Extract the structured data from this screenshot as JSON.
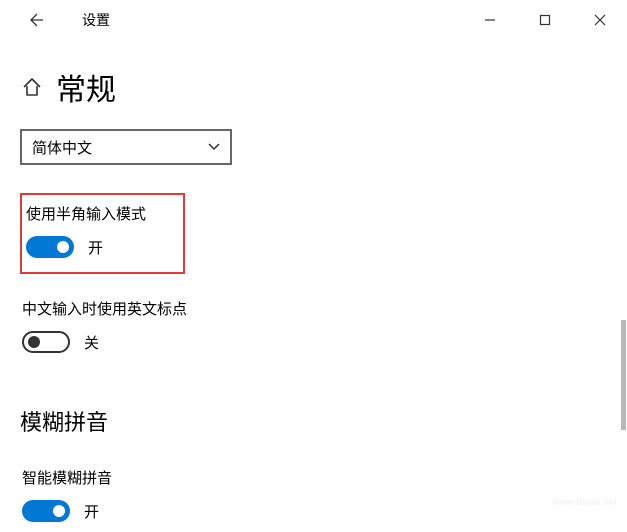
{
  "titlebar": {
    "title": "设置"
  },
  "page": {
    "heading": "常规"
  },
  "dropdown": {
    "selected": "简体中文"
  },
  "settings": {
    "halfwidth": {
      "label": "使用半角输入模式",
      "state": "开"
    },
    "englishPunctuation": {
      "label": "中文输入时使用英文标点",
      "state": "关"
    }
  },
  "sections": {
    "fuzzyPinyin": {
      "heading": "模糊拼音",
      "smart": {
        "label": "智能模糊拼音",
        "state": "开"
      }
    }
  },
  "watermark": "www.dnxtc.net"
}
